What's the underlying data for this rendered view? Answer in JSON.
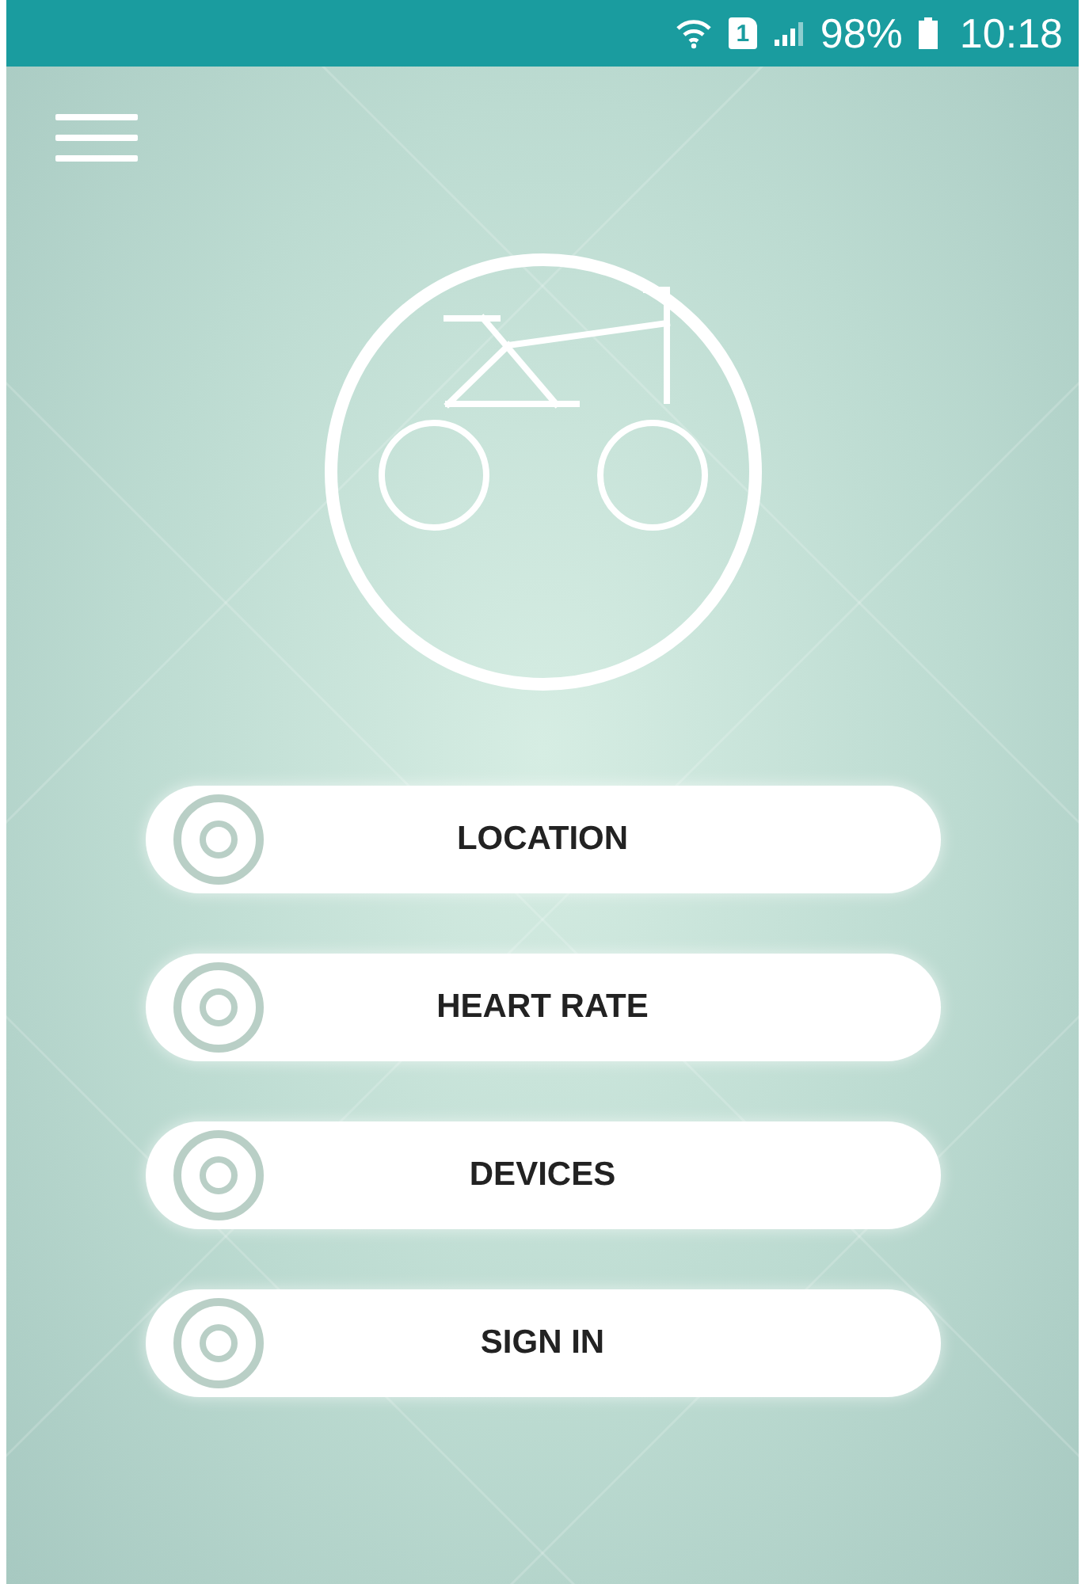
{
  "status_bar": {
    "sim_slot": "1",
    "battery": "98%",
    "time": "10:18"
  },
  "menu_items": [
    {
      "label": "LOCATION"
    },
    {
      "label": "HEART RATE"
    },
    {
      "label": "DEVICES"
    },
    {
      "label": "SIGN IN"
    }
  ]
}
